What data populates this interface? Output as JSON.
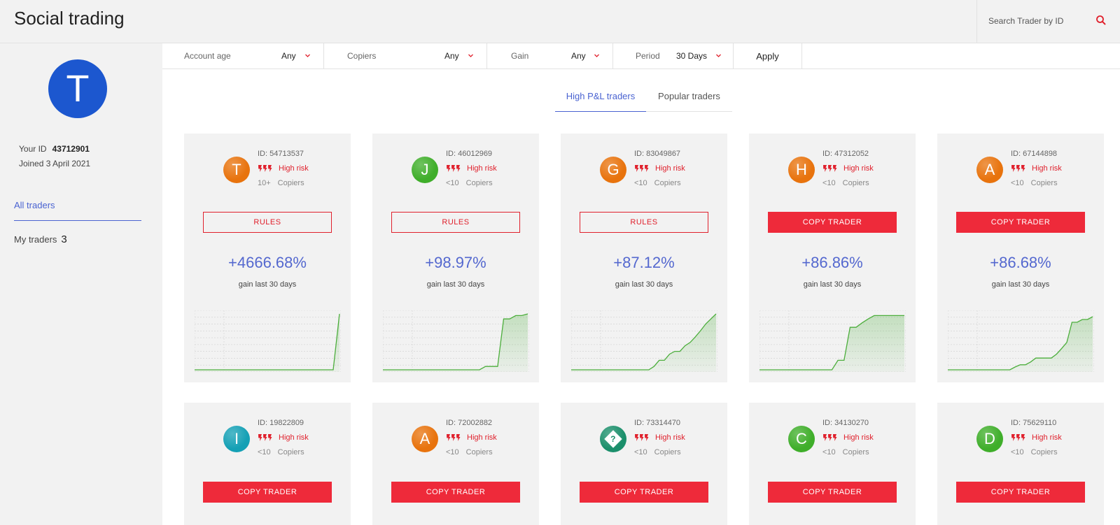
{
  "header": {
    "title": "Social trading",
    "search_placeholder": "Search Trader by ID"
  },
  "sidebar": {
    "avatar_letter": "T",
    "your_id_label": "Your ID",
    "your_id_value": "43712901",
    "joined": "Joined 3 April 2021",
    "nav": {
      "all_traders": "All traders",
      "my_traders": "My traders",
      "my_traders_count": "3"
    }
  },
  "filters": [
    {
      "label": "Account age",
      "value": "Any"
    },
    {
      "label": "Copiers",
      "value": "Any"
    },
    {
      "label": "Gain",
      "value": "Any"
    },
    {
      "label": "Period",
      "value": "30 Days"
    }
  ],
  "apply_label": "Apply",
  "tabs": {
    "high": "High P&L traders",
    "popular": "Popular traders"
  },
  "colors": {
    "accent": "#4a63d1",
    "risk": "#e0202c",
    "copy_button": "#ee2a3a",
    "gain": "#5468cf",
    "chart_line": "#4cae3c"
  },
  "risk_icon": "lightning-bolts-icon",
  "traders": [
    {
      "avatar": "T",
      "avatar_color": "#e8730d",
      "id": "ID: 54713537",
      "risk": "High risk",
      "copiers_count": "10+",
      "copiers_label": "Copiers",
      "button": "RULES",
      "button_type": "rules",
      "gain": "+4666.68%",
      "gain_label": "gain last 30 days",
      "equity": [
        0,
        0,
        0,
        0,
        0,
        0,
        0,
        0,
        0,
        0,
        0,
        0,
        0,
        0,
        0,
        0,
        0,
        0,
        0,
        0,
        0,
        0,
        0,
        100
      ]
    },
    {
      "avatar": "J",
      "avatar_color": "#3fae2a",
      "id": "ID: 46012969",
      "risk": "High risk",
      "copiers_count": "<10",
      "copiers_label": "Copiers",
      "button": "RULES",
      "button_type": "rules",
      "gain": "+98.97%",
      "gain_label": "gain last 30 days",
      "equity": [
        0,
        0,
        0,
        0,
        0,
        0,
        0,
        0,
        0,
        0,
        0,
        0,
        0,
        0,
        0,
        0,
        0,
        6,
        6,
        6,
        91,
        91,
        97,
        97,
        100
      ]
    },
    {
      "avatar": "G",
      "avatar_color": "#e8730d",
      "id": "ID: 83049867",
      "risk": "High risk",
      "copiers_count": "<10",
      "copiers_label": "Copiers",
      "button": "RULES",
      "button_type": "rules",
      "gain": "+87.12%",
      "gain_label": "gain last 30 days",
      "equity": [
        0,
        0,
        0,
        0,
        0,
        0,
        0,
        0,
        0,
        0,
        0,
        0,
        0,
        0,
        0,
        0,
        6,
        17,
        17,
        28,
        33,
        33,
        43,
        49,
        59,
        70,
        82,
        91,
        100
      ]
    },
    {
      "avatar": "H",
      "avatar_color": "#e8730d",
      "id": "ID: 47312052",
      "risk": "High risk",
      "copiers_count": "<10",
      "copiers_label": "Copiers",
      "button": "COPY TRADER",
      "button_type": "copy",
      "gain": "+86.86%",
      "gain_label": "gain last 30 days",
      "equity": [
        0,
        0,
        0,
        0,
        0,
        0,
        0,
        0,
        0,
        0,
        0,
        0,
        0,
        17,
        17,
        76,
        76,
        84,
        91,
        97,
        97,
        97,
        97,
        97,
        97
      ]
    },
    {
      "avatar": "A",
      "avatar_color": "#e8730d",
      "id": "ID: 67144898",
      "risk": "High risk",
      "copiers_count": "<10",
      "copiers_label": "Copiers",
      "button": "COPY TRADER",
      "button_type": "copy",
      "gain": "+86.68%",
      "gain_label": "gain last 30 days",
      "equity": [
        0,
        0,
        0,
        0,
        0,
        0,
        0,
        0,
        0,
        0,
        0,
        0,
        0,
        5,
        9,
        9,
        14,
        21,
        21,
        21,
        21,
        28,
        38,
        49,
        85,
        85,
        90,
        90,
        95
      ]
    },
    {
      "avatar": "I",
      "avatar_color": "#14a0b5",
      "id": "ID: 19822809",
      "risk": "High risk",
      "copiers_count": "<10",
      "copiers_label": "Copiers",
      "button": "COPY TRADER",
      "button_type": "copy"
    },
    {
      "avatar": "A",
      "avatar_color": "#e8730d",
      "id": "ID: 72002882",
      "risk": "High risk",
      "copiers_count": "<10",
      "copiers_label": "Copiers",
      "button": "COPY TRADER",
      "button_type": "copy"
    },
    {
      "avatar": "?",
      "avatar_color": "#1b8f6b",
      "avatar_icon": "question-diamond-icon",
      "id": "ID: 73314470",
      "risk": "High risk",
      "copiers_count": "<10",
      "copiers_label": "Copiers",
      "button": "COPY TRADER",
      "button_type": "copy"
    },
    {
      "avatar": "C",
      "avatar_color": "#3fae2a",
      "id": "ID: 34130270",
      "risk": "High risk",
      "copiers_count": "<10",
      "copiers_label": "Copiers",
      "button": "COPY TRADER",
      "button_type": "copy"
    },
    {
      "avatar": "D",
      "avatar_color": "#3fae2a",
      "id": "ID: 75629110",
      "risk": "High risk",
      "copiers_count": "<10",
      "copiers_label": "Copiers",
      "button": "COPY TRADER",
      "button_type": "copy"
    }
  ]
}
